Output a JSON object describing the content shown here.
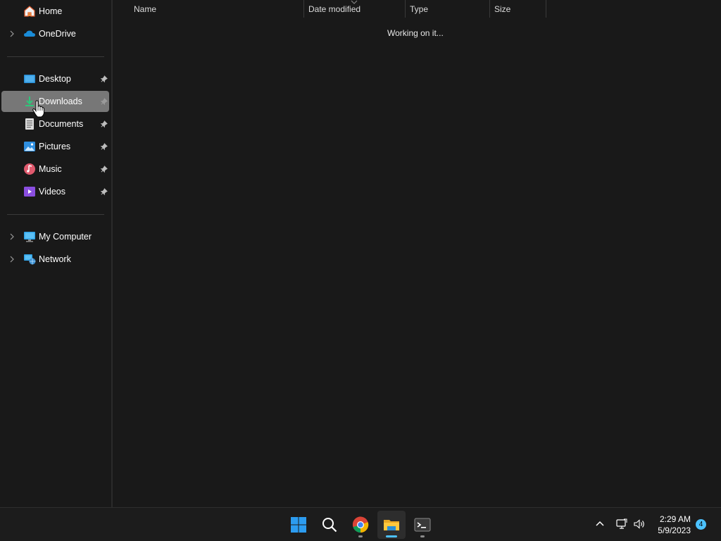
{
  "nav": {
    "items": [
      {
        "label": "Home",
        "icon": "home-icon",
        "expandable": false,
        "pinned": false
      },
      {
        "label": "OneDrive",
        "icon": "onedrive-icon",
        "expandable": true,
        "pinned": false
      },
      {
        "label": "Desktop",
        "icon": "desktop-folder-icon",
        "expandable": false,
        "pinned": true
      },
      {
        "label": "Downloads",
        "icon": "downloads-folder-icon",
        "expandable": false,
        "pinned": true,
        "selected": true
      },
      {
        "label": "Documents",
        "icon": "documents-folder-icon",
        "expandable": false,
        "pinned": true
      },
      {
        "label": "Pictures",
        "icon": "pictures-folder-icon",
        "expandable": false,
        "pinned": true
      },
      {
        "label": "Music",
        "icon": "music-folder-icon",
        "expandable": false,
        "pinned": true
      },
      {
        "label": "Videos",
        "icon": "videos-folder-icon",
        "expandable": false,
        "pinned": true
      },
      {
        "label": "My Computer",
        "icon": "computer-icon",
        "expandable": true,
        "pinned": false
      },
      {
        "label": "Network",
        "icon": "network-icon",
        "expandable": true,
        "pinned": false
      }
    ]
  },
  "content": {
    "columns": [
      "Name",
      "Date modified",
      "Type",
      "Size"
    ],
    "status": "Working on it..."
  },
  "taskbar": {
    "apps": [
      "start-icon",
      "search-icon",
      "chrome-icon",
      "file-explorer-icon",
      "terminal-icon"
    ],
    "active_app": "file-explorer-icon",
    "tray": [
      "show-hidden-icons-chevron",
      "network-icon",
      "volume-icon"
    ],
    "time": "2:29 AM",
    "date": "5/9/2023",
    "notification_count": "4"
  },
  "colors": {
    "background": "#191919",
    "selected": "#777777",
    "accent": "#4cc2ff"
  }
}
